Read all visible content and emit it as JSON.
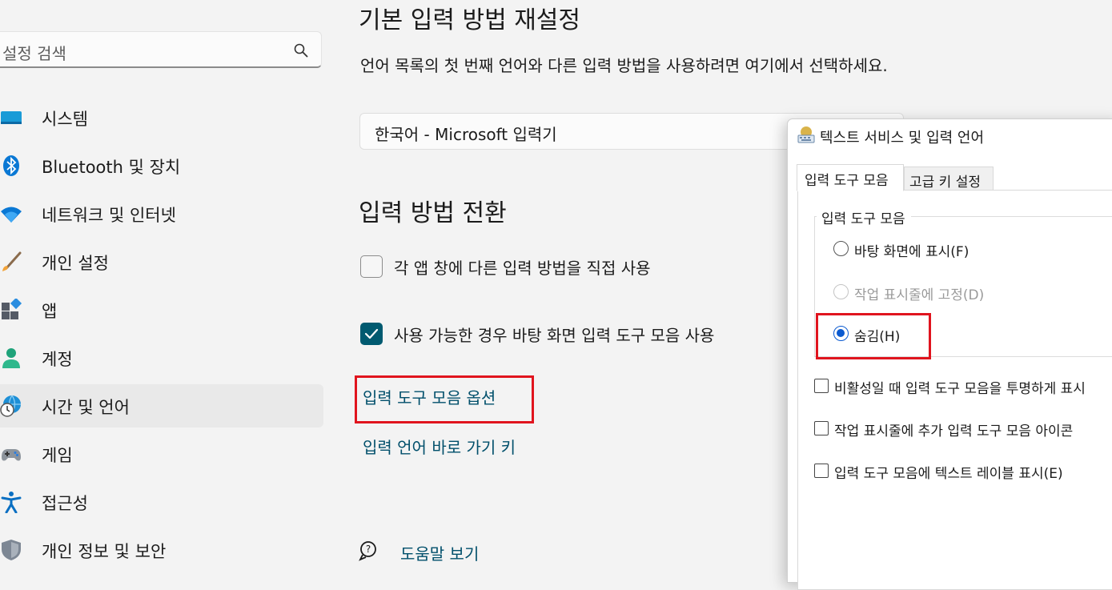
{
  "sidebar": {
    "search_placeholder": "설정 검색",
    "items": [
      {
        "label": "시스템",
        "icon": "system-icon"
      },
      {
        "label": "Bluetooth 및 장치",
        "icon": "bluetooth-icon"
      },
      {
        "label": "네트워크 및 인터넷",
        "icon": "wifi-icon"
      },
      {
        "label": "개인 설정",
        "icon": "brush-icon"
      },
      {
        "label": "앱",
        "icon": "apps-icon"
      },
      {
        "label": "계정",
        "icon": "account-icon"
      },
      {
        "label": "시간 및 언어",
        "icon": "globe-clock-icon",
        "selected": true
      },
      {
        "label": "게임",
        "icon": "gamepad-icon"
      },
      {
        "label": "접근성",
        "icon": "accessibility-icon"
      },
      {
        "label": "개인 정보 및 보안",
        "icon": "shield-icon"
      }
    ]
  },
  "main": {
    "default_input_title": "기본 입력 방법 재설정",
    "default_input_desc": "언어 목록의 첫 번째 언어와 다른 입력 방법을 사용하려면 여기에서 선택하세요.",
    "default_input_value": "한국어 - Microsoft 입력기",
    "switch_title": "입력 방법 전환",
    "per_app_label": "각 앱 창에 다른 입력 방법을 직접 사용",
    "per_app_checked": false,
    "desktop_bar_label": "사용 가능한 경우 바탕 화면 입력 도구 모음 사용",
    "desktop_bar_checked": true,
    "language_bar_options_link": "입력 도구 모음 옵션",
    "hotkeys_link": "입력 언어 바로 가기 키",
    "help_link": "도움말 보기"
  },
  "dialog": {
    "title": "텍스트 서비스 및 입력 언어",
    "tabs": [
      "입력 도구 모음",
      "고급 키 설정"
    ],
    "active_tab": 0,
    "group_title": "입력 도구 모음",
    "radios": [
      {
        "label": "바탕 화면에 표시(F)",
        "state": "off"
      },
      {
        "label": "작업 표시줄에 고정(D)",
        "state": "disabled"
      },
      {
        "label": "숨김(H)",
        "state": "on"
      }
    ],
    "checkboxes": [
      "비활성일 때 입력 도구 모음을 투명하게 표시",
      "작업 표시줄에 추가 입력 도구 모음 아이콘",
      "입력 도구 모음에 텍스트 레이블 표시(E)"
    ]
  },
  "colors": {
    "accent": "#005a70",
    "link": "#004f6b",
    "highlight_box": "#e0141e",
    "radio_selected": "#0a5ad0"
  }
}
